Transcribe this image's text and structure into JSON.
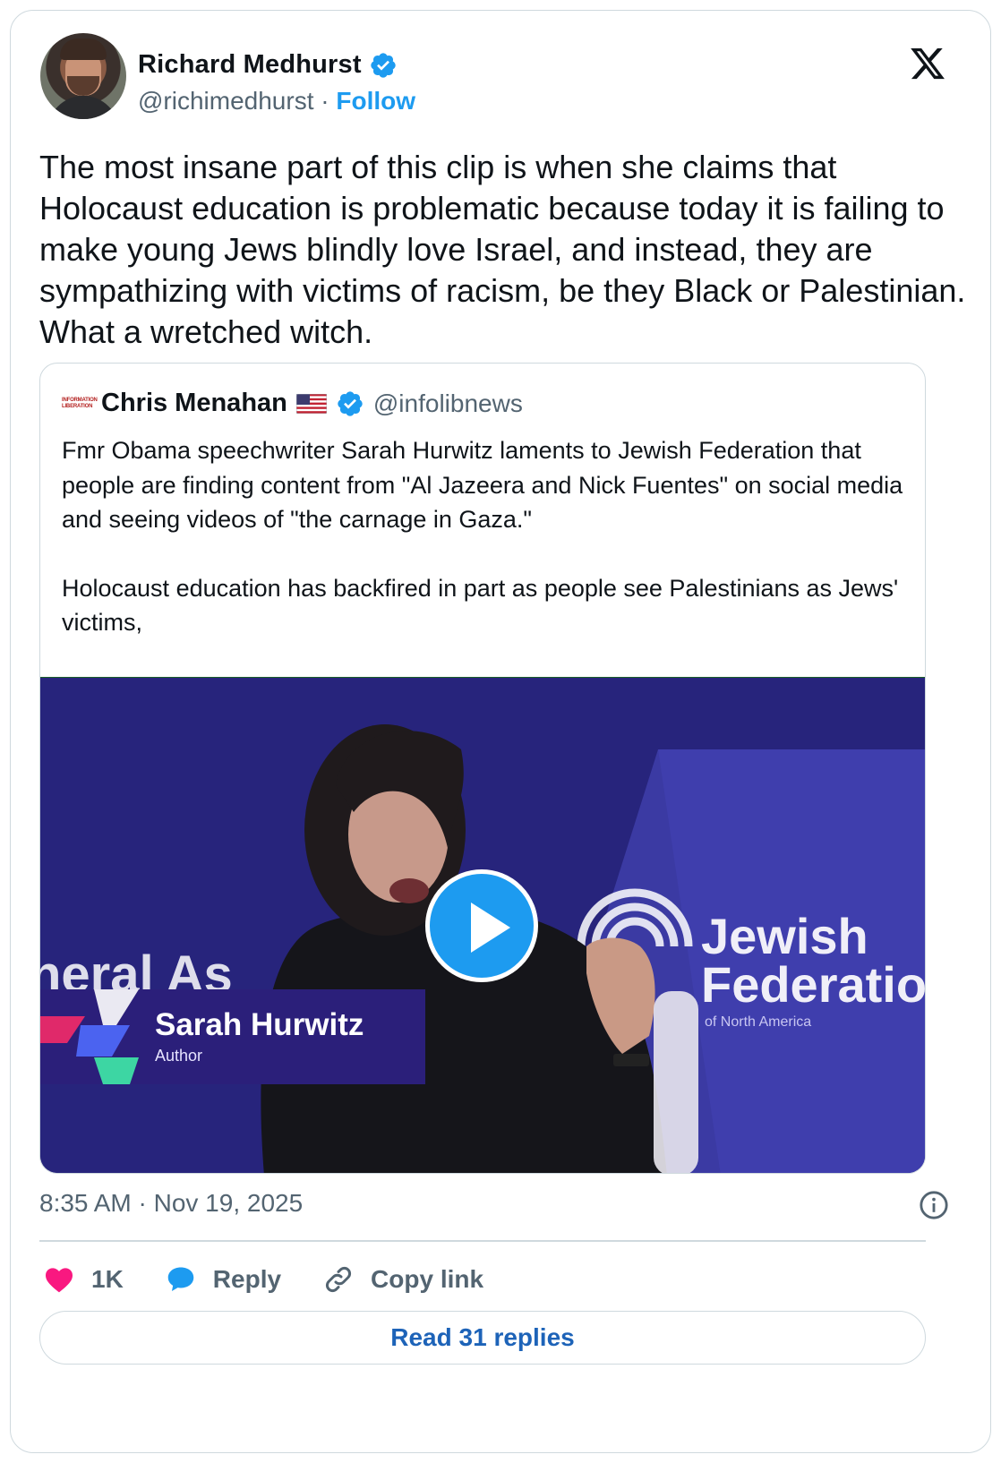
{
  "author": {
    "name": "Richard Medhurst",
    "handle": "@richimedhurst",
    "separator": "·",
    "follow_label": "Follow"
  },
  "tweet": {
    "text": "The most insane part of this clip is when she claims that Holocaust education is problematic because today it is failing to make young Jews blindly love Israel, and instead, they are sympathizing with victims of racism, be they Black or Palestinian. What a wretched witch.",
    "timestamp": "8:35 AM · Nov 19, 2025"
  },
  "quoted": {
    "logo_text": [
      "INFORMATION",
      "LIBERATION"
    ],
    "name": "Chris Menahan",
    "handle": "@infolibnews",
    "paragraphs": [
      "Fmr Obama speechwriter Sarah Hurwitz laments to Jewish Federation that people are finding content from \"Al Jazeera and Nick Fuentes\" on social media and seeing videos of \"the carnage in Gaza.\"",
      "Holocaust education has backfired in part as people see Palestinians as Jews' victims,"
    ],
    "video": {
      "lower_third_name": "Sarah Hurwitz",
      "lower_third_role": "Author",
      "backdrop_left": "neral As",
      "backdrop_right": [
        "Jewish",
        "Federatio"
      ],
      "backdrop_right_sub": "of North America"
    }
  },
  "actions": {
    "like_count": "1K",
    "reply_label": "Reply",
    "copy_label": "Copy link"
  },
  "read_replies_label": "Read 31 replies",
  "colors": {
    "accent": "#1d9bf0",
    "text": "#0f1419",
    "muted": "#536471",
    "like": "#f91880",
    "border": "#cfd9de",
    "video_bg": "#26237a"
  },
  "icons": [
    "verified-badge-icon",
    "x-logo-icon",
    "us-flag-icon",
    "play-icon",
    "info-icon",
    "heart-icon",
    "reply-bubble-icon",
    "link-icon"
  ]
}
